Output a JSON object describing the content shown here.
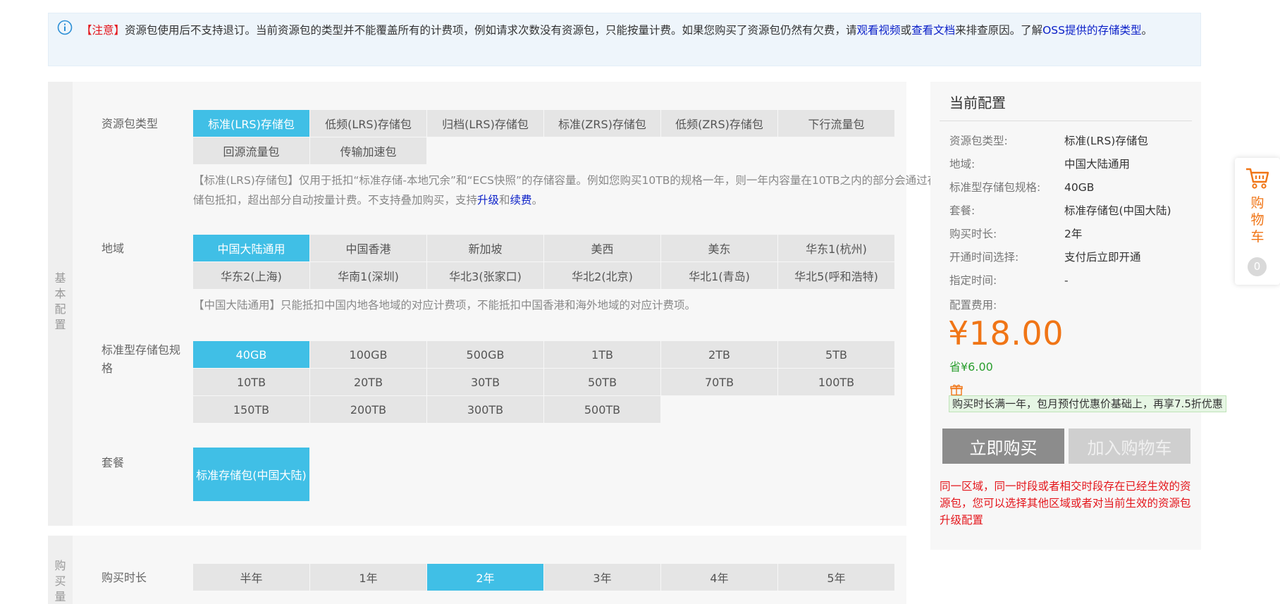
{
  "notice": {
    "tag": "【注意】",
    "text1": "资源包使用后不支持退订。当前资源包的类型并不能覆盖所有的计费项，例如请求次数没有资源包，只能按量计费。如果您购买了资源包仍然有欠费，请",
    "link_video": "观看视频",
    "text2": "或",
    "link_doc": "查看文档",
    "text3": "来排查原因。了解",
    "link_types": "OSS提供的存储类型",
    "text4": "。"
  },
  "basic": {
    "side_label": [
      "基",
      "本",
      "配",
      "置"
    ],
    "package_type": {
      "label": "资源包类型",
      "options": [
        "标准(LRS)存储包",
        "低频(LRS)存储包",
        "归档(LRS)存储包",
        "标准(ZRS)存储包",
        "低频(ZRS)存储包",
        "下行流量包",
        "回源流量包",
        "传输加速包"
      ],
      "selected": 0,
      "desc_text1": "【标准(LRS)存储包】仅用于抵扣“标准存储-本地冗余”和“ECS快照”的存储容量。例如您购买10TB的规格一年，则一年内容量在10TB之内的部分会通过存储包抵扣，超出部分自动按量计费。不支持叠加购买，支持",
      "desc_link_upgrade": "升级",
      "desc_text2": "和",
      "desc_link_renew": "续费",
      "desc_text3": "。"
    },
    "region": {
      "label": "地域",
      "options": [
        "中国大陆通用",
        "中国香港",
        "新加坡",
        "美西",
        "美东",
        "华东1(杭州)",
        "华东2(上海)",
        "华南1(深圳)",
        "华北3(张家口)",
        "华北2(北京)",
        "华北1(青岛)",
        "华北5(呼和浩特)"
      ],
      "selected": 0,
      "desc": "【中国大陆通用】只能抵扣中国内地各地域的对应计费项，不能抵扣中国香港和海外地域的对应计费项。"
    },
    "spec": {
      "label_line1": "标准型存储包规",
      "label_line2": "格",
      "options": [
        "40GB",
        "100GB",
        "500GB",
        "1TB",
        "2TB",
        "5TB",
        "10TB",
        "20TB",
        "30TB",
        "50TB",
        "70TB",
        "100TB",
        "150TB",
        "200TB",
        "300TB",
        "500TB"
      ],
      "selected": 0
    },
    "plan": {
      "label": "套餐",
      "options": [
        "标准存储包(中国大陆)"
      ],
      "selected": 0
    }
  },
  "purchase": {
    "side_label": [
      "购",
      "买",
      "量"
    ],
    "duration": {
      "label": "购买时长",
      "options": [
        "半年",
        "1年",
        "2年",
        "3年",
        "4年",
        "5年"
      ],
      "selected": 2
    }
  },
  "panel": {
    "title": "当前配置",
    "items": [
      {
        "k": "资源包类型:",
        "v": "标准(LRS)存储包"
      },
      {
        "k": "地域:",
        "v": "中国大陆通用"
      },
      {
        "k": "标准型存储包规格:",
        "v": "40GB"
      },
      {
        "k": "套餐:",
        "v": "标准存储包(中国大陆)"
      },
      {
        "k": "购买时长:",
        "v": "2年"
      },
      {
        "k": "开通时间选择:",
        "v": "支付后立即开通"
      },
      {
        "k": "指定时间:",
        "v": "-"
      }
    ],
    "fee_label": "配置费用:",
    "price": "¥18.00",
    "save": "省¥6.00",
    "promo": "购买时长满一年，包月预付优惠价基础上，再享7.5折优惠",
    "buy_label": "立即购买",
    "cart_label": "加入购物车",
    "warning": "同一区域，同一时段或者相交时段存在已经生效的资源包，您可以选择其他区域或者对当前生效的资源包升级配置"
  },
  "float_cart": {
    "label": [
      "购",
      "物",
      "车"
    ],
    "count": "0"
  },
  "colors": {
    "selected": "#40bfe6",
    "option_bg": "#e5e5e5",
    "price": "#f07516",
    "warning": "#e4151b",
    "link": "#0a1fc8",
    "save": "#2a9e2e"
  }
}
